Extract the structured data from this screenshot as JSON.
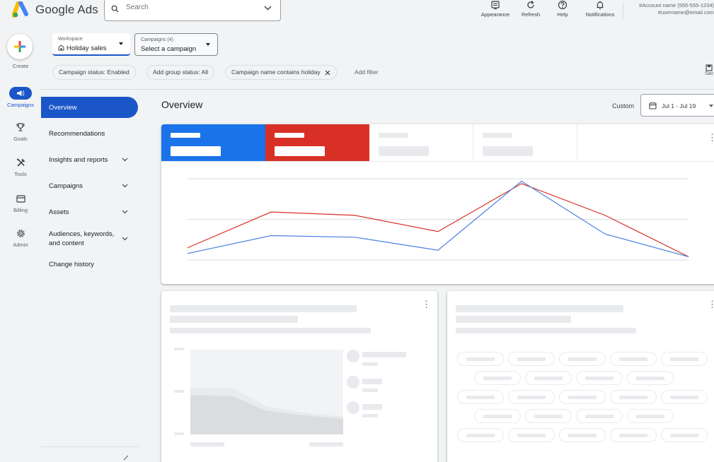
{
  "header": {
    "brand": "Google Ads",
    "search_placeholder": "Search",
    "buttons": [
      {
        "label": "Appearance",
        "icon": "appearance-icon"
      },
      {
        "label": "Refresh",
        "icon": "refresh-icon"
      },
      {
        "label": "Help",
        "icon": "help-icon"
      },
      {
        "label": "Notifications",
        "icon": "bell-icon"
      }
    ],
    "account_name": "#Account name (555-555-1234)",
    "account_email": "#username@email.com"
  },
  "rail": {
    "create_label": "Create",
    "items": [
      {
        "label": "Campaigns",
        "icon": "megaphone-icon",
        "active": true
      },
      {
        "label": "Goals",
        "icon": "trophy-icon"
      },
      {
        "label": "Tools",
        "icon": "tools-icon"
      },
      {
        "label": "Billing",
        "icon": "billing-icon"
      },
      {
        "label": "Admin",
        "icon": "admin-gear-icon"
      }
    ]
  },
  "toolbar": {
    "workspace_caption": "Workspace",
    "workspace_value": "Holiday sales",
    "campaigns_caption": "Campaigns (4)",
    "campaigns_value": "Select a campaign",
    "filters": [
      "Campaign status: Enabled",
      "Add group status: All",
      "Campaign name contains holiday"
    ],
    "add_filter": "Add filter",
    "save_label": "Sav"
  },
  "nav": {
    "items": [
      {
        "label": "Overview",
        "active": true
      },
      {
        "label": "Recommendations"
      },
      {
        "label": "Insights and reports",
        "expandable": true
      },
      {
        "label": "Campaigns",
        "expandable": true
      },
      {
        "label": "Assets",
        "expandable": true
      },
      {
        "label": "Audiences, keywords,",
        "label2": "and content",
        "expandable": true
      },
      {
        "label": "Change history"
      }
    ]
  },
  "main": {
    "title": "Overview",
    "date_mode": "Custom",
    "date_range": "Jul 1 - Jul 19"
  },
  "colors": {
    "accent": "#1a73e8",
    "blue_series": "#4a7fe0",
    "red_series": "#d93025",
    "tile_blue": "#1a73e8",
    "tile_red": "#d93025"
  },
  "chart_data": {
    "type": "line",
    "title": "",
    "x": [
      1,
      2,
      3,
      4,
      5,
      6,
      7
    ],
    "ylim": [
      0,
      100
    ],
    "grid": true,
    "series": [
      {
        "color": "#d93025",
        "values": [
          15,
          59,
          55,
          35,
          94,
          55,
          4
        ]
      },
      {
        "color": "#4a7fe0",
        "values": [
          8,
          30,
          28,
          12,
          97,
          32,
          4
        ]
      }
    ]
  }
}
